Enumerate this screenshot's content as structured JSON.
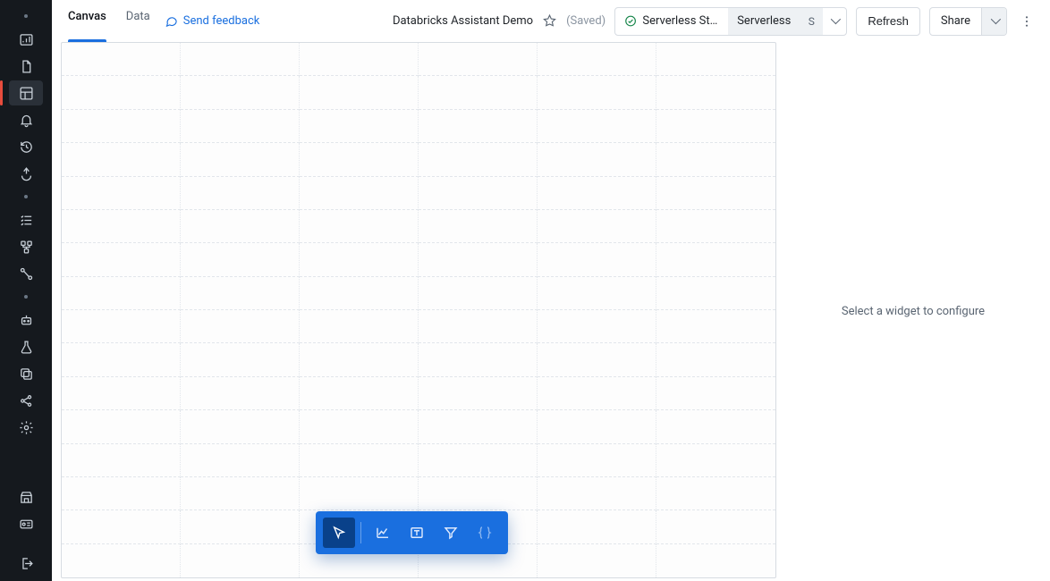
{
  "leftnav": {
    "items_top": [
      {
        "name": "chart-bar-icon"
      },
      {
        "name": "sheet-icon"
      },
      {
        "name": "dashboard-icon",
        "active": true
      },
      {
        "name": "bell-icon"
      },
      {
        "name": "history-icon"
      },
      {
        "name": "ingest-icon"
      }
    ],
    "items_mid": [
      {
        "name": "checklist-icon"
      },
      {
        "name": "schema-icon"
      },
      {
        "name": "pipeline-icon"
      }
    ],
    "items_low": [
      {
        "name": "robot-icon"
      },
      {
        "name": "flask-icon"
      },
      {
        "name": "stack-icon"
      },
      {
        "name": "share-nodes-icon"
      },
      {
        "name": "gear-icon"
      }
    ],
    "items_bottom": [
      {
        "name": "store-icon"
      },
      {
        "name": "card-icon"
      }
    ],
    "footer": {
      "name": "logout-icon"
    }
  },
  "topbar": {
    "tabs": [
      {
        "label": "Canvas",
        "active": true
      },
      {
        "label": "Data",
        "active": false
      }
    ],
    "feedback_label": "Send feedback",
    "title": "Databricks Assistant Demo",
    "saved_label": "(Saved)",
    "compute": {
      "status_label": "Serverless Sta…",
      "name": "Serverless",
      "avatar": "S"
    },
    "refresh_label": "Refresh",
    "share_label": "Share"
  },
  "canvas": {
    "toolbar_tools": [
      {
        "name": "cursor-tool",
        "selected": true
      },
      {
        "name": "chart-tool"
      },
      {
        "name": "text-tool"
      },
      {
        "name": "filter-tool"
      },
      {
        "name": "code-tool",
        "dim": true
      }
    ]
  },
  "right_panel": {
    "empty_message": "Select a widget to configure"
  }
}
